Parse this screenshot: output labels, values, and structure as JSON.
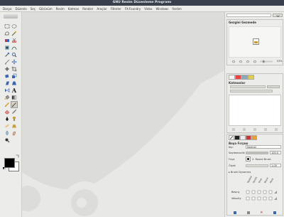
{
  "window": {
    "title": "GNU Resim Düzenleme Programı"
  },
  "menu": [
    "Dosya",
    "Düzenle",
    "Seç",
    "Görünüm",
    "Resim",
    "Katman",
    "Renkler",
    "Araçlar",
    "Filtreler",
    "FX-Foundry",
    "Video",
    "Windows",
    "Yardım"
  ],
  "dock": {
    "tab_selector": "",
    "navigator": {
      "title": "Gezgini Gezmede",
      "zoom": "53%"
    },
    "layers": {
      "title": "Katmanlar"
    },
    "tool_options": {
      "title": "Boya Fırçası",
      "mode_label": "Kip:",
      "mode_value": "Normal",
      "opacity_label": "Saydamsızlık",
      "opacity_value": "100.0",
      "brush_label": "Fırça",
      "brush_value": "2. Round Brush",
      "scale_label": "Ölçek",
      "scale_value": "1.00",
      "dynamics_label": "Brush Dynamics",
      "dyn_columns": [
        "Opaklık",
        "Sertlik",
        "Oran",
        "Boyut",
        "Renk"
      ],
      "dyn_rows": [
        "Basınç",
        "Velocity"
      ]
    }
  },
  "colors": {
    "accent": "#3a3f4c",
    "fg": "#000000",
    "bg": "#ffffff",
    "canvas": "#dcdcda",
    "logo": "#e8e8e6"
  }
}
